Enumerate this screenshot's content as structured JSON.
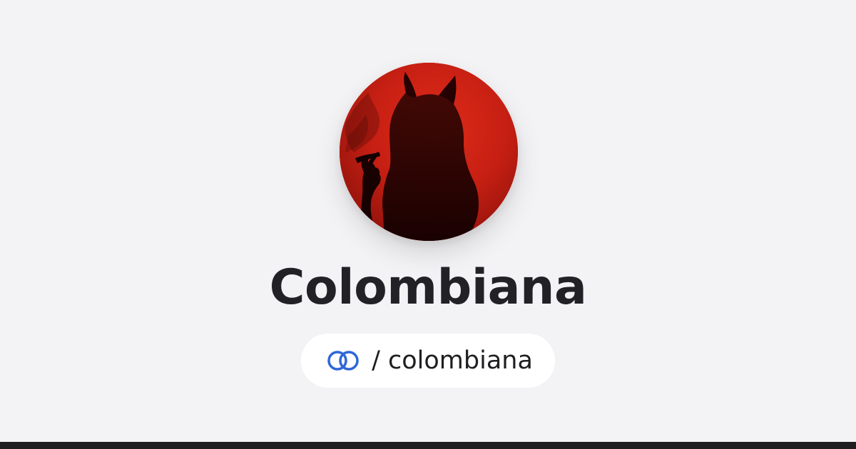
{
  "profile": {
    "display_name": "Colombiana",
    "handle_text": "/ colombiana",
    "brand_icon": "interlinked-rings-icon",
    "avatar_subject": "red-devil-silhouette-avatar"
  },
  "colors": {
    "background": "#f3f3f5",
    "text": "#222226",
    "pill_background": "#ffffff",
    "brand_blue": "#2f67d8",
    "avatar_red": "#c92014",
    "bottom_bar": "#1f1f22"
  }
}
